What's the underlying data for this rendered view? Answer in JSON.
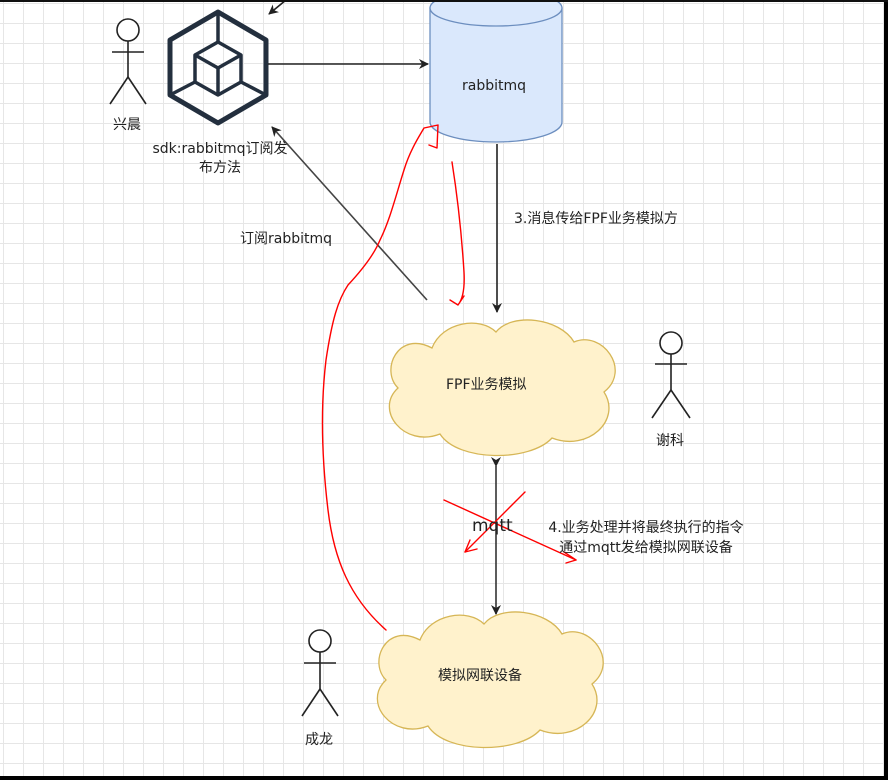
{
  "actors": {
    "xingchen": "兴晨",
    "xieke": "谢科",
    "chenglong": "成龙"
  },
  "nodes": {
    "rabbitmq": "rabbitmq",
    "fpf": "FPF业务模拟",
    "device": "模拟网联设备"
  },
  "edges": {
    "sdk_label_line1": "sdk:rabbitmq订阅发",
    "sdk_label_line2": "布方法",
    "subscribe_label": "订阅rabbitmq",
    "step3_label": "3.消息传给FPF业务模拟方",
    "mqtt_label": "mqtt",
    "step4_line1": "4.业务处理并将最终执行的指令",
    "step4_line2": "通过mqtt发给模拟网联设备"
  },
  "colors": {
    "cylinder_fill": "#dae8fc",
    "cylinder_stroke": "#6c8ebf",
    "cloud_fill": "#fff2cc",
    "cloud_stroke": "#d6b656",
    "annotation_red": "#ff0000",
    "component_icon": "#232f3e"
  },
  "icons": {
    "component": "cube-component-icon"
  }
}
